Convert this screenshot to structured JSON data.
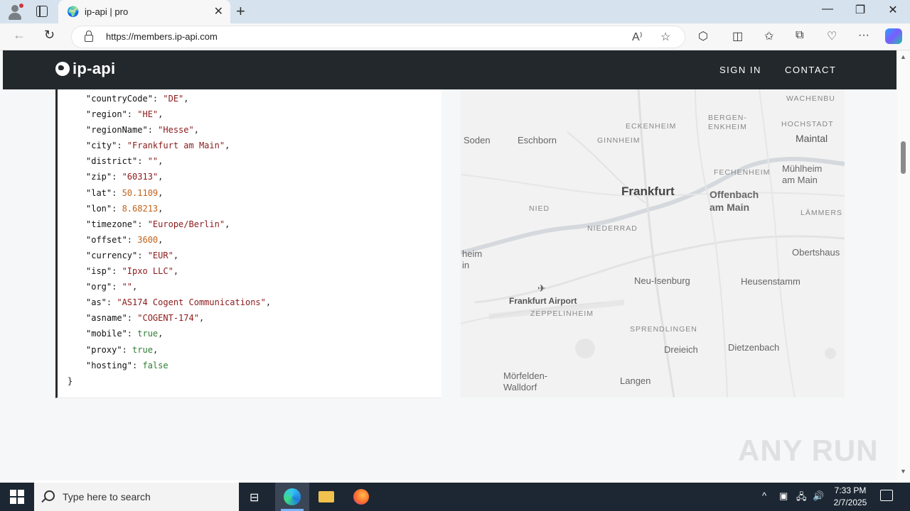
{
  "browser": {
    "tab_title": "ip-api | pro",
    "url": "https://members.ip-api.com",
    "url_scheme": "https://",
    "url_host": "members.ip-api.com"
  },
  "site": {
    "logo": "ip-api",
    "nav": {
      "sign_in": "SIGN IN",
      "contact": "CONTACT"
    }
  },
  "json_response": {
    "lines": [
      {
        "key": "\"countryCode\"",
        "value": "\"DE\"",
        "type": "s",
        "comma": true
      },
      {
        "key": "\"region\"",
        "value": "\"HE\"",
        "type": "s",
        "comma": true
      },
      {
        "key": "\"regionName\"",
        "value": "\"Hesse\"",
        "type": "s",
        "comma": true
      },
      {
        "key": "\"city\"",
        "value": "\"Frankfurt am Main\"",
        "type": "s",
        "comma": true
      },
      {
        "key": "\"district\"",
        "value": "\"\"",
        "type": "s",
        "comma": true
      },
      {
        "key": "\"zip\"",
        "value": "\"60313\"",
        "type": "s",
        "comma": true
      },
      {
        "key": "\"lat\"",
        "value": "50.1109",
        "type": "n",
        "comma": true
      },
      {
        "key": "\"lon\"",
        "value": "8.68213",
        "type": "n",
        "comma": true
      },
      {
        "key": "\"timezone\"",
        "value": "\"Europe/Berlin\"",
        "type": "s",
        "comma": true
      },
      {
        "key": "\"offset\"",
        "value": "3600",
        "type": "n",
        "comma": true
      },
      {
        "key": "\"currency\"",
        "value": "\"EUR\"",
        "type": "s",
        "comma": true
      },
      {
        "key": "\"isp\"",
        "value": "\"Ipxo LLC\"",
        "type": "s",
        "comma": true
      },
      {
        "key": "\"org\"",
        "value": "\"\"",
        "type": "s",
        "comma": true
      },
      {
        "key": "\"as\"",
        "value": "\"AS174 Cogent Communications\"",
        "type": "s",
        "comma": true
      },
      {
        "key": "\"asname\"",
        "value": "\"COGENT-174\"",
        "type": "s",
        "comma": true
      },
      {
        "key": "\"mobile\"",
        "value": "true",
        "type": "b",
        "comma": true
      },
      {
        "key": "\"proxy\"",
        "value": "true",
        "type": "b",
        "comma": true
      },
      {
        "key": "\"hosting\"",
        "value": "false",
        "type": "b",
        "comma": false
      }
    ],
    "closing_brace": "}"
  },
  "map_labels": {
    "frankfurt": "Frankfurt",
    "offenbach": "Offenbach\nam Main",
    "soden": "Soden",
    "eschborn": "Eschborn",
    "eckenheim": "ECKENHEIM",
    "ginnheim": "GINNHEIM",
    "bergen": "BERGEN-\nENKHEIM",
    "hochstadt": "HOCHSTADT",
    "wachenbu": "WACHENBU",
    "maintal": "Maintal",
    "fechenheim": "FECHENHEIM",
    "muehlheim": "Mühlheim\nam Main",
    "laemmers": "LÄMMERS",
    "nied": "NIED",
    "niederrad": "NIEDERRAD",
    "obertshaus": "Obertshaus",
    "heim": "heim\nin",
    "neuisenburg": "Neu-Isenburg",
    "heusenstamm": "Heusenstamm",
    "airport": "Frankfurt Airport",
    "zeppelinheim": "ZEPPELINHEIM",
    "sprendlingen": "SPRENDLINGEN",
    "dreieich": "Dreieich",
    "dietzenbach": "Dietzenbach",
    "moerfelden": "Mörfelden-\nWalldorf",
    "langen": "Langen"
  },
  "watermark": "ANY RUN",
  "taskbar": {
    "search_placeholder": "Type here to search",
    "time": "7:33 PM",
    "date": "2/7/2025"
  }
}
